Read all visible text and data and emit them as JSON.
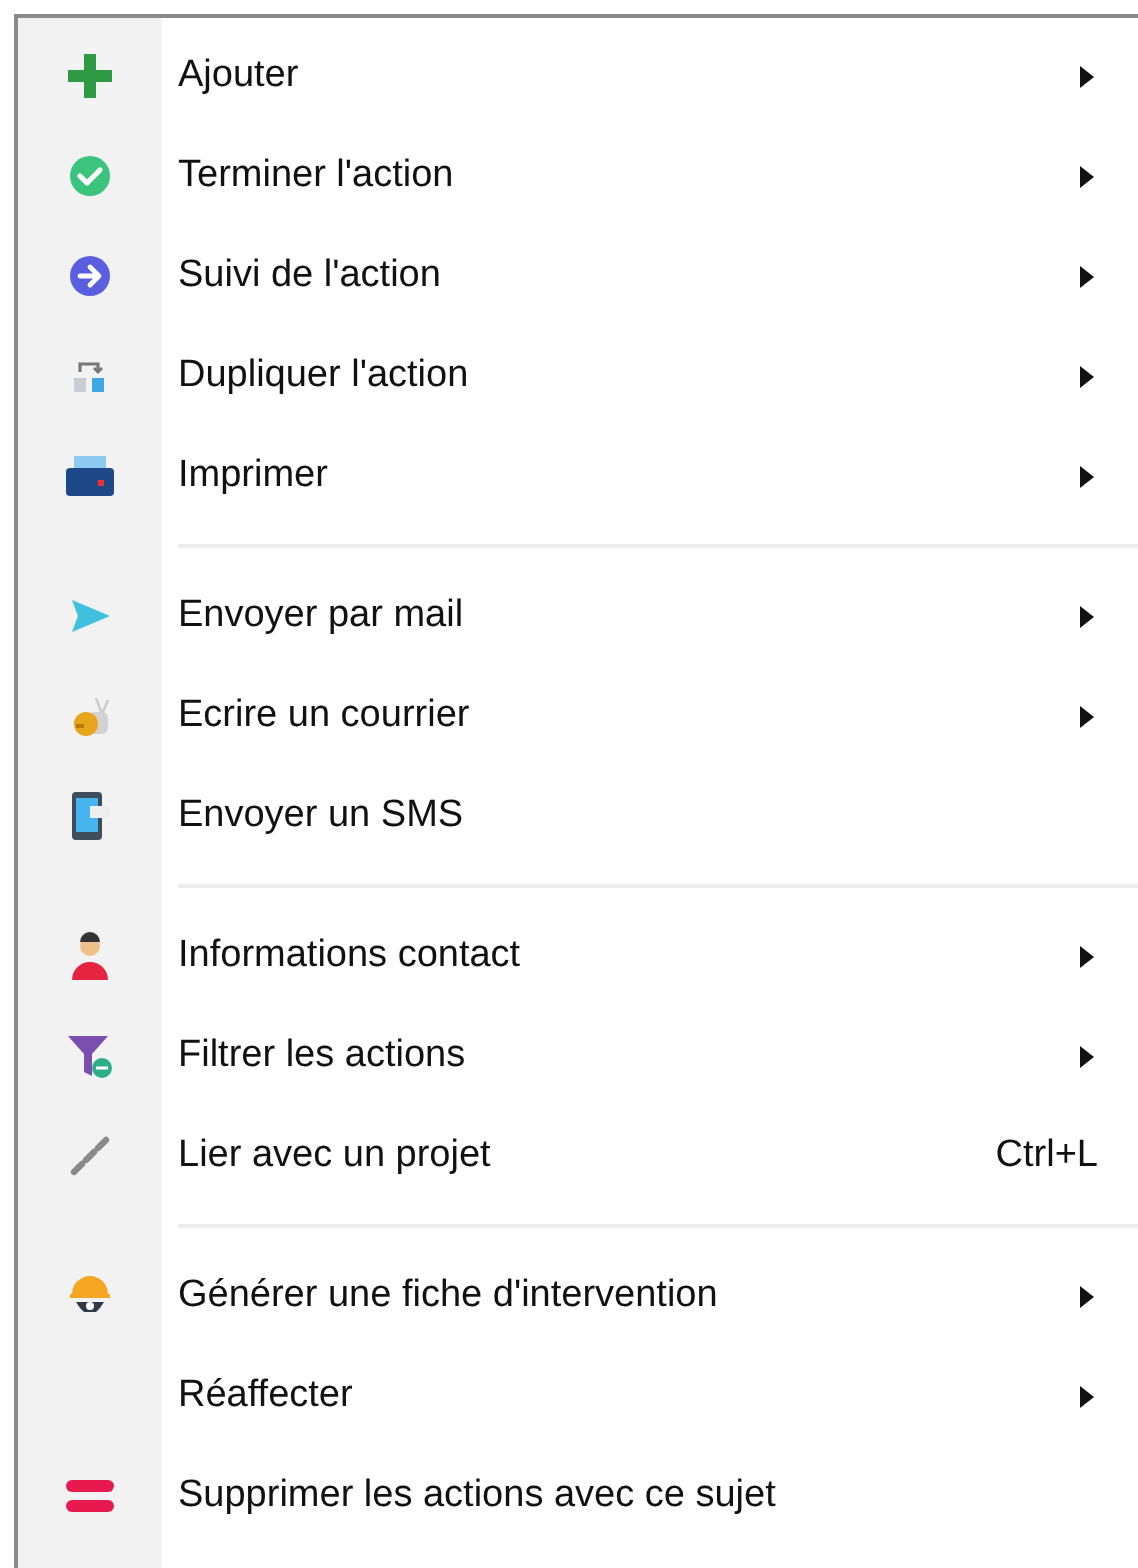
{
  "menu": {
    "entries": [
      {
        "kind": "item",
        "label": "Ajouter",
        "submenu": true
      },
      {
        "kind": "item",
        "label": "Terminer l'action",
        "submenu": true
      },
      {
        "kind": "item",
        "label": "Suivi de l'action",
        "submenu": true
      },
      {
        "kind": "item",
        "label": "Dupliquer l'action",
        "submenu": true
      },
      {
        "kind": "item",
        "label": "Imprimer",
        "submenu": true
      },
      {
        "kind": "separator"
      },
      {
        "kind": "item",
        "label": "Envoyer par mail",
        "submenu": true
      },
      {
        "kind": "item",
        "label": "Ecrire un courrier",
        "submenu": true
      },
      {
        "kind": "item",
        "label": "Envoyer un SMS",
        "submenu": false
      },
      {
        "kind": "separator"
      },
      {
        "kind": "item",
        "label": "Informations contact",
        "submenu": true
      },
      {
        "kind": "item",
        "label": "Filtrer les actions",
        "submenu": true
      },
      {
        "kind": "item",
        "label": "Lier avec un projet",
        "submenu": false,
        "shortcut": "Ctrl+L"
      },
      {
        "kind": "separator"
      },
      {
        "kind": "item",
        "label": "Générer une fiche d'intervention",
        "submenu": true
      },
      {
        "kind": "item",
        "label": "Réaffecter",
        "submenu": true
      },
      {
        "kind": "item",
        "label": "Supprimer les actions avec ce sujet",
        "submenu": false
      }
    ]
  }
}
